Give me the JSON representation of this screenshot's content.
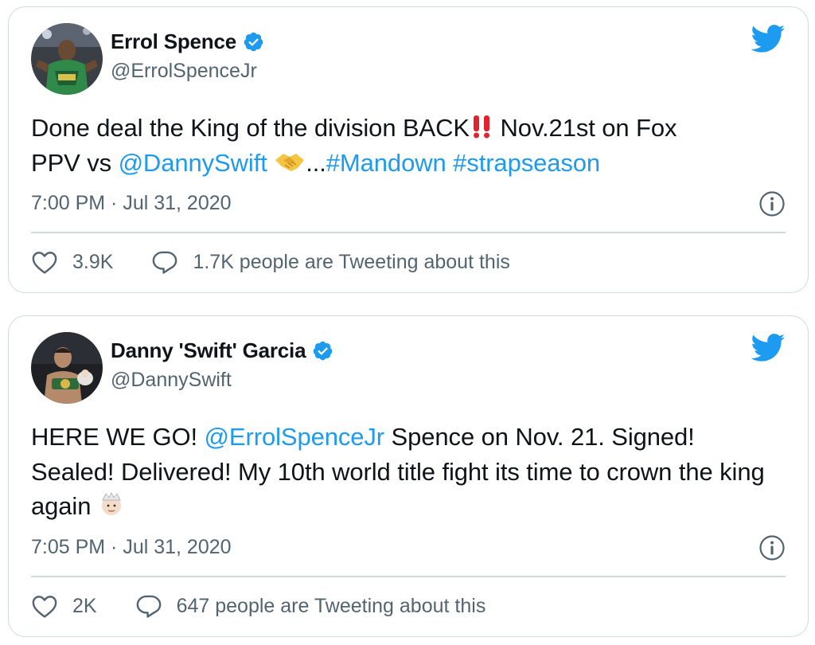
{
  "tweets": [
    {
      "author": {
        "name": "Errol Spence",
        "handle": "@ErrolSpenceJr",
        "verified": true
      },
      "text": {
        "line1_pre": "Done deal the King of the division BACK",
        "line1_post": " Nov.21st on Fox",
        "line2_pre": "PPV vs ",
        "mention": "@DannySwift",
        "ellipsis": "...",
        "hashtag1": "#Mandown",
        "space": " ",
        "hashtag2": "#strapseason"
      },
      "emojis": [
        "double-exclamation-icon",
        "handshake-icon"
      ],
      "timestamp": "7:00 PM · Jul 31, 2020",
      "likes": "3.9K",
      "conversation": "1.7K people are Tweeting about this"
    },
    {
      "author": {
        "name": "Danny 'Swift' Garcia",
        "handle": "@DannySwift",
        "verified": true
      },
      "text": {
        "pre": "HERE WE GO! ",
        "mention": "@ErrolSpenceJr",
        "post": " Spence on Nov. 21. Signed! Sealed! Delivered! My 10th world title fight its time to crown the king again "
      },
      "emojis": [
        "prince-crown-icon"
      ],
      "timestamp": "7:05 PM · Jul 31, 2020",
      "likes": "2K",
      "conversation": "647 people are Tweeting about this"
    }
  ],
  "colors": {
    "link": "#1d9bf0",
    "verified": "#1d9bf0",
    "secondary_text": "#536471",
    "border": "#cfd9de",
    "primary_text": "#0f1419"
  }
}
